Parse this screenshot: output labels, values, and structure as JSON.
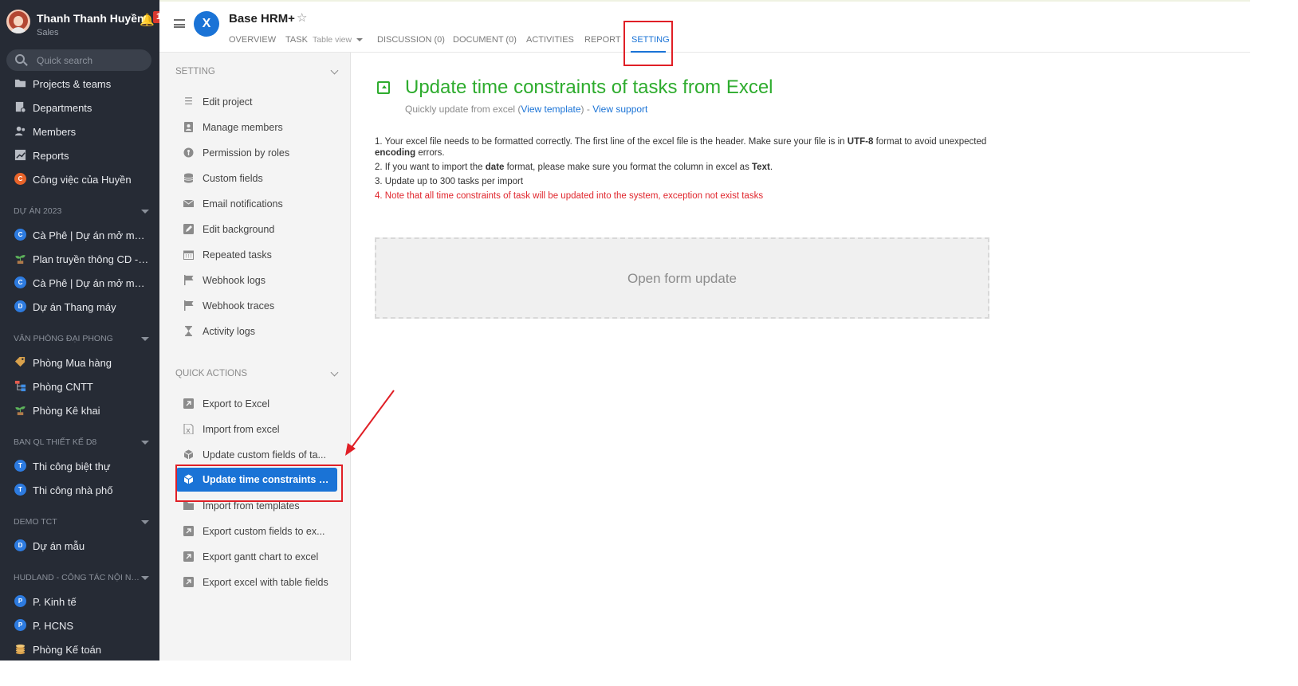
{
  "sidebar": {
    "user": {
      "name": "Thanh Thanh Huyền",
      "role": "Sales",
      "notification_count": "1"
    },
    "search_placeholder": "Quick search",
    "main_items": [
      {
        "label": "Projects & teams",
        "icon": "folder-icon"
      },
      {
        "label": "Departments",
        "icon": "departments-icon"
      },
      {
        "label": "Members",
        "icon": "members-icon"
      },
      {
        "label": "Reports",
        "icon": "chart-icon"
      },
      {
        "label": "Công việc của Huyền",
        "icon": "c-circle-icon",
        "letter": "C"
      }
    ],
    "sections": [
      {
        "title": "DỰ ÁN 2023",
        "items": [
          {
            "label": "Cà Phê | Dự án mở mới c...",
            "letter": "C"
          },
          {
            "label": "Plan truyền thông CD - M...",
            "letter": ""
          },
          {
            "label": "Cà Phê | Dự án mở mở V...",
            "letter": "C"
          },
          {
            "label": "Dự án Thang máy",
            "letter": "D"
          }
        ]
      },
      {
        "title": "VĂN PHÒNG ĐẠI PHONG",
        "items": [
          {
            "label": "Phòng Mua hàng",
            "letter": ""
          },
          {
            "label": "Phòng CNTT",
            "letter": ""
          },
          {
            "label": "Phòng Kê khai",
            "letter": ""
          }
        ]
      },
      {
        "title": "BAN QL THIẾT KẾ D8",
        "items": [
          {
            "label": "Thi công biệt thự",
            "letter": "T"
          },
          {
            "label": "Thi công nhà phố",
            "letter": "T"
          }
        ]
      },
      {
        "title": "DEMO TCT",
        "items": [
          {
            "label": "Dự án mẫu",
            "letter": "D"
          }
        ]
      },
      {
        "title": "HUDLAND - CÔNG TÁC NỘI NG...",
        "items": [
          {
            "label": "P. Kinh tế",
            "letter": "P"
          },
          {
            "label": "P. HCNS",
            "letter": "P"
          },
          {
            "label": "Phòng Kế toán",
            "letter": ""
          }
        ]
      }
    ]
  },
  "header": {
    "project_title": "Base HRM+",
    "logo_letter": "X",
    "tabs": [
      {
        "label": "OVERVIEW"
      },
      {
        "label": "TASK",
        "sub": "Table view"
      },
      {
        "label": "DISCUSSION (0)"
      },
      {
        "label": "DOCUMENT (0)"
      },
      {
        "label": "ACTIVITIES"
      },
      {
        "label": "REPORT"
      },
      {
        "label": "SETTING",
        "active": true
      }
    ]
  },
  "panel": {
    "setting_title": "SETTING",
    "setting_items": [
      {
        "label": "Edit project",
        "icon": "list-icon"
      },
      {
        "label": "Manage members",
        "icon": "member-card-icon"
      },
      {
        "label": "Permission by roles",
        "icon": "permission-icon"
      },
      {
        "label": "Custom fields",
        "icon": "database-icon"
      },
      {
        "label": "Email notifications",
        "icon": "envelope-icon"
      },
      {
        "label": "Edit background",
        "icon": "edit-icon"
      },
      {
        "label": "Repeated tasks",
        "icon": "calendar-icon"
      },
      {
        "label": "Webhook logs",
        "icon": "flag-icon"
      },
      {
        "label": "Webhook traces",
        "icon": "flag-icon"
      },
      {
        "label": "Activity logs",
        "icon": "hourglass-icon"
      }
    ],
    "quick_title": "QUICK ACTIONS",
    "quick_items": [
      {
        "label": "Export to Excel",
        "icon": "export-icon"
      },
      {
        "label": "Import from excel",
        "icon": "excel-file-icon"
      },
      {
        "label": "Update custom fields of ta...",
        "icon": "cube-icon"
      },
      {
        "label": "Update time constraints of...",
        "icon": "cube-icon",
        "active": true
      },
      {
        "label": "Import from templates",
        "icon": "folder-icon"
      },
      {
        "label": "Export custom fields to ex...",
        "icon": "export-icon"
      },
      {
        "label": "Export gantt chart to excel",
        "icon": "export-icon"
      },
      {
        "label": "Export excel with table fields",
        "icon": "export-icon"
      }
    ]
  },
  "main": {
    "title": "Update time constraints of tasks from Excel",
    "subtitle_prefix": "Quickly update from excel (",
    "view_template": "View template",
    "subtitle_mid": ") - ",
    "view_support": "View support",
    "notes": {
      "n1_a": "1. Your excel file needs to be formatted correctly. The first line of the excel file is the header. Make sure your file is in ",
      "n1_b": "UTF-8",
      "n1_c": " format to avoid unexpected ",
      "n1_d": "encoding",
      "n1_e": " errors.",
      "n2_a": "2. If you want to import the ",
      "n2_b": "date",
      "n2_c": " format, please make sure you format the column in excel as ",
      "n2_d": "Text",
      "n2_e": ".",
      "n3": "3. Update up to 300 tasks per import",
      "n4": "4. Note that all time constraints of task will be updated into the system, exception not exist tasks"
    },
    "open_form": "Open form update"
  },
  "colors": {
    "accent": "#1a73d6",
    "title_green": "#2eac2e",
    "warning_red": "#e0262d",
    "highlight_red": "#e01f26",
    "sidebar_bg": "#262b35"
  }
}
